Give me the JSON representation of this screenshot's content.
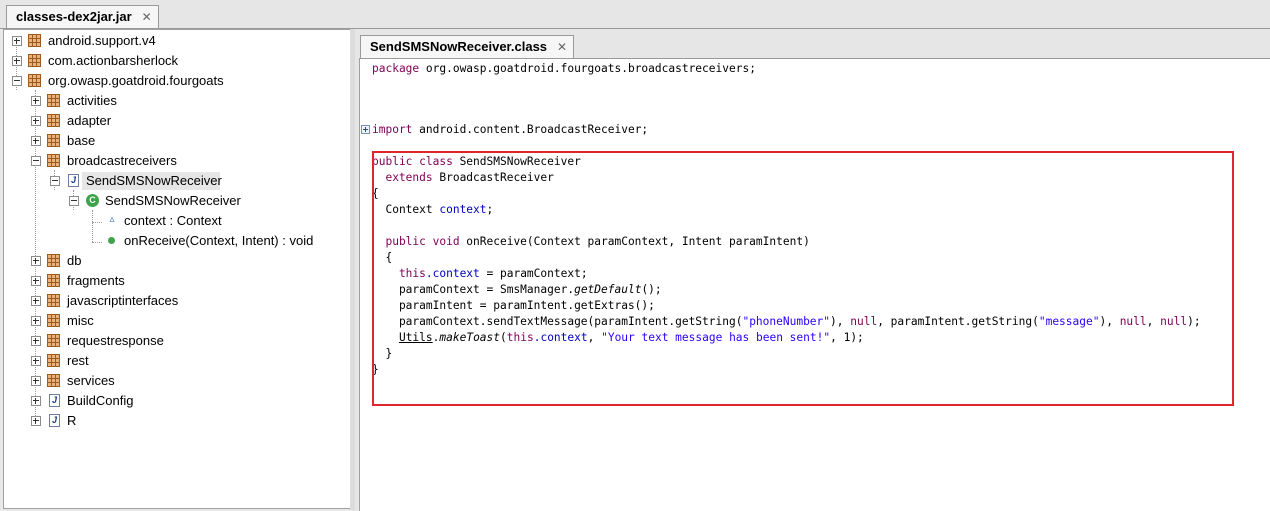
{
  "top_tab": {
    "label": "classes-dex2jar.jar",
    "close": "✕"
  },
  "tree": {
    "root_items": [
      {
        "label": "android.support.v4"
      },
      {
        "label": "com.actionbarsherlock"
      },
      {
        "label": "org.owasp.goatdroid.fourgoats"
      }
    ],
    "packages": [
      {
        "label": "activities"
      },
      {
        "label": "adapter"
      },
      {
        "label": "base"
      },
      {
        "label": "broadcastreceivers"
      }
    ],
    "file_item": {
      "label": "SendSMSNowReceiver"
    },
    "class_item": {
      "label": "SendSMSNowReceiver"
    },
    "members": [
      {
        "label": "context : Context"
      },
      {
        "label": "onReceive(Context, Intent) : void"
      }
    ],
    "more_packages": [
      {
        "label": "db"
      },
      {
        "label": "fragments"
      },
      {
        "label": "javascriptinterfaces"
      },
      {
        "label": "misc"
      },
      {
        "label": "requestresponse"
      },
      {
        "label": "rest"
      },
      {
        "label": "services"
      }
    ],
    "classes": [
      {
        "label": "BuildConfig"
      },
      {
        "label": "R"
      }
    ]
  },
  "code_tab": {
    "label": "SendSMSNowReceiver.class",
    "close": "✕"
  },
  "code": {
    "package_kw": "package",
    "package_name": " org.owasp.goatdroid.fourgoats.broadcastreceivers;",
    "import_kw": "import",
    "import_name": " android.content.BroadcastReceiver;",
    "public_class_kw": "public class",
    "class_name": " SendSMSNowReceiver",
    "extends_kw": "  extends",
    "extends_name": " BroadcastReceiver",
    "open_brace": "{",
    "field_type": "  Context ",
    "field_name": "context",
    "field_semicolon": ";",
    "method_kw": "  public void",
    "method_sig": " onReceive(Context paramContext, Intent paramIntent)",
    "method_open": "  {",
    "this_kw": "    this",
    "this_ctx": ".context",
    "assign1": " = paramContext;",
    "line_getdefault_a": "    paramContext = SmsManager.",
    "line_getdefault_b": "getDefault",
    "line_getdefault_c": "();",
    "line_extras": "    paramIntent = paramIntent.getExtras();",
    "send_a": "    paramContext.sendTextMessage(paramIntent.getString(",
    "send_str1": "\"phoneNumber\"",
    "send_b": "), ",
    "send_null1": "null",
    "send_c": ", paramIntent.getString(",
    "send_str2": "\"message\"",
    "send_d": "), ",
    "send_null2": "null",
    "send_e": ", ",
    "send_null3": "null",
    "send_f": ");",
    "toast_indent": "    ",
    "toast_utils": "Utils",
    "toast_dot": ".",
    "toast_method": "makeToast",
    "toast_paren": "(",
    "toast_this": "this",
    "toast_ctx": ".context",
    "toast_comma": ", ",
    "toast_str": "\"Your text message has been sent!\"",
    "toast_end": ", 1);",
    "method_close": "  }",
    "class_close": "}"
  },
  "colors": {
    "highlight_border": "#e0262d",
    "keyword": "#7f0055",
    "field": "#0000c0",
    "string": "#2a00ff"
  }
}
